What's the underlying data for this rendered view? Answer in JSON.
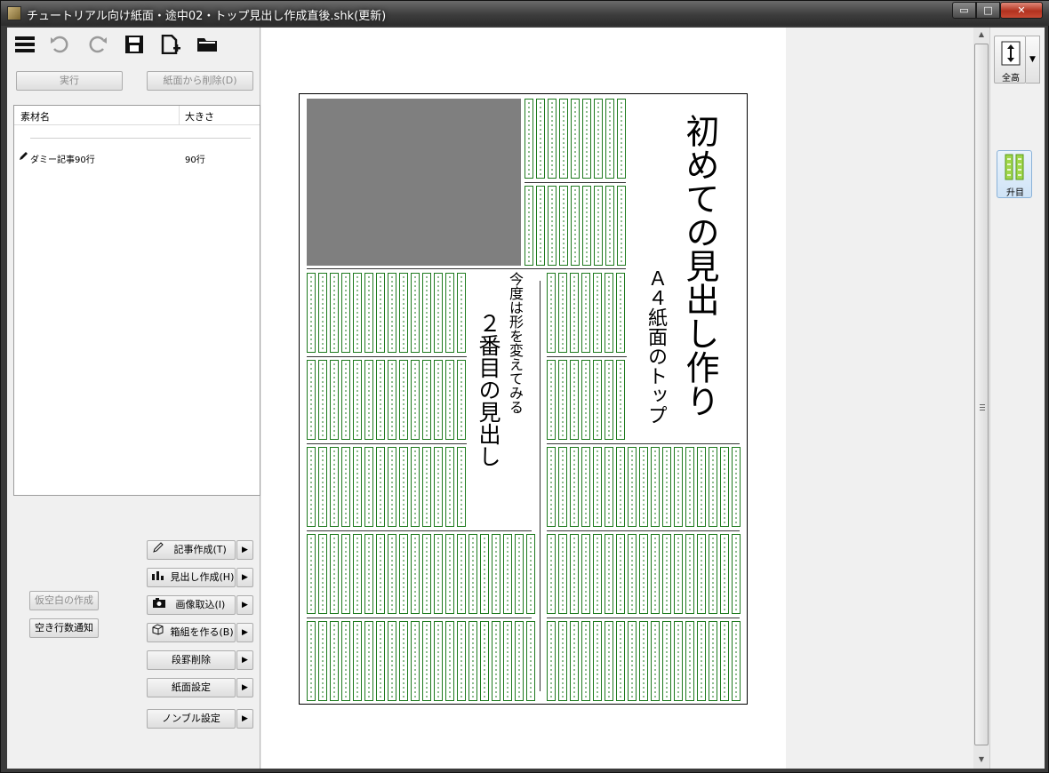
{
  "window": {
    "title": "チュートリアル向け紙面・途中02・トップ見出し作成直後.shk(更新)",
    "controls": {
      "minimize": "▭",
      "maximize": "□",
      "close": "✕"
    }
  },
  "toolbar": {
    "icons": [
      "menu-icon",
      "undo-icon",
      "redo-icon",
      "save-icon",
      "new-file-icon",
      "open-folder-icon"
    ]
  },
  "left_panel": {
    "execute_label": "実行",
    "delete_label": "紙面から削除(D)",
    "list": {
      "headers": {
        "name": "素材名",
        "size": "大きさ"
      },
      "rows": [
        {
          "name": "ダミー記事90行",
          "size": "90行"
        }
      ]
    },
    "actions": {
      "article": "記事作成(T)",
      "heading": "見出し作成(H)",
      "image": "画像取込(I)",
      "box": "箱組を作る(B)",
      "divide": "段罫削除",
      "paper": "紙面設定",
      "nombre": "ノンブル設定"
    },
    "temp_blank": "仮空白の作成",
    "empty_lines": "空き行数通知"
  },
  "canvas": {
    "headline_main": "初めての見出し作り",
    "headline_sub": "Ａ４紙面のトップ",
    "headline2_main": "２番目の見出し",
    "headline2_sub": "今度は形を変えてみる"
  },
  "right_bar": {
    "zoom_label": "全高",
    "grid_label": "升目"
  },
  "colors": {
    "grid_green": "#1e7a1e",
    "photo_gray": "#7f7f7f"
  }
}
